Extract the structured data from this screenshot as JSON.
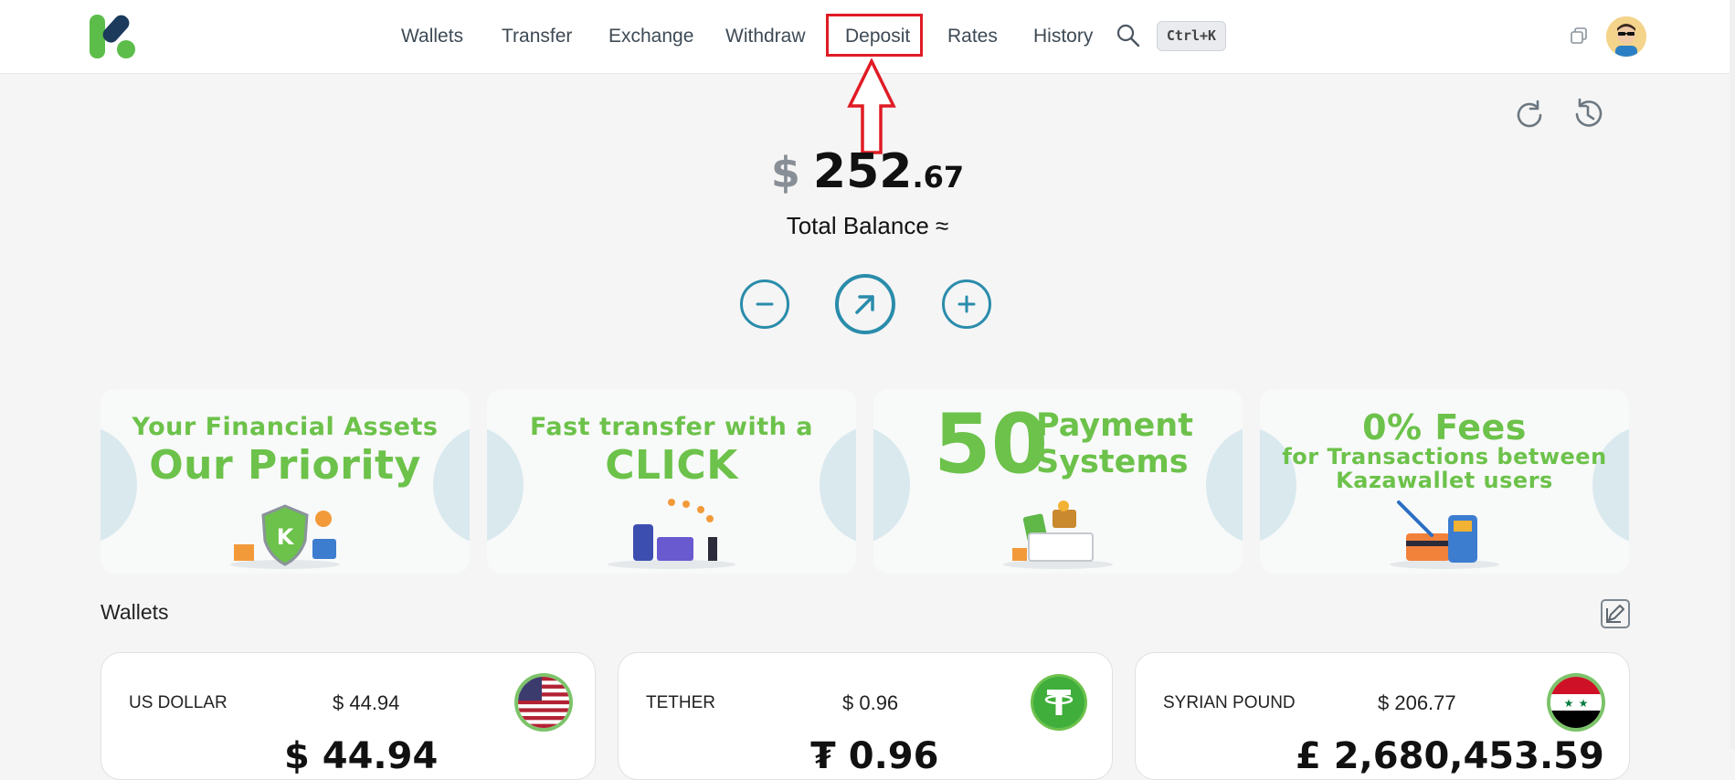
{
  "nav": {
    "items": [
      "Wallets",
      "Transfer",
      "Exchange",
      "Withdraw",
      "Deposit",
      "Rates",
      "History"
    ],
    "shortcut": "Ctrl+K"
  },
  "balance": {
    "currency_symbol": "$",
    "integer": "252",
    "decimal": ".67",
    "label": "Total Balance ≈"
  },
  "banners": [
    {
      "line1": "Your Financial Assets",
      "line2": "Our Priority"
    },
    {
      "line1": "Fast transfer with a",
      "line2": "CLICK"
    },
    {
      "big": "50",
      "line1": "Payment",
      "line2": "Systems"
    },
    {
      "line1": "0% Fees",
      "line2": "for Transactions between",
      "line3": "Kazawallet users"
    }
  ],
  "wallets": {
    "title": "Wallets",
    "cards": [
      {
        "name": "US DOLLAR",
        "usd": "$ 44.94",
        "amount_partial": "$ 44.94",
        "flag": "us-flag-icon"
      },
      {
        "name": "TETHER",
        "usd": "$ 0.96",
        "amount_partial": "₮ 0.96",
        "flag": "tether-icon"
      },
      {
        "name": "SYRIAN POUND",
        "usd": "$ 206.77",
        "amount_partial": "£ 2,680,453.59",
        "flag": "syria-flag-icon"
      }
    ]
  },
  "colors": {
    "accent": "#2a8cab",
    "banner_green": "#6cc24a",
    "highlight_red": "#e01b24",
    "logo_green": "#5cbd4a",
    "logo_navy": "#1b3a5c"
  }
}
